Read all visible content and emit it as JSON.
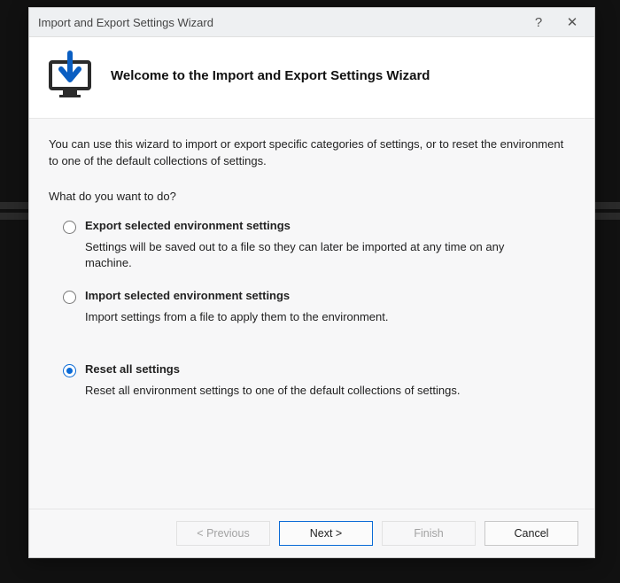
{
  "titlebar": {
    "title": "Import and Export Settings Wizard",
    "help_label": "?",
    "close_label": "✕"
  },
  "header": {
    "heading": "Welcome to the Import and Export Settings Wizard",
    "icon_name": "monitor-download-icon"
  },
  "body": {
    "intro": "You can use this wizard to import or export specific categories of settings, or to reset the environment to one of the default collections of settings.",
    "prompt": "What do you want to do?"
  },
  "options": [
    {
      "label": "Export selected environment settings",
      "desc": "Settings will be saved out to a file so they can later be imported at any time on any machine.",
      "selected": false
    },
    {
      "label": "Import selected environment settings",
      "desc": "Import settings from a file to apply them to the environment.",
      "selected": false
    },
    {
      "label": "Reset all settings",
      "desc": "Reset all environment settings to one of the default collections of settings.",
      "selected": true
    }
  ],
  "footer": {
    "previous": "< Previous",
    "next": "Next >",
    "finish": "Finish",
    "cancel": "Cancel"
  }
}
